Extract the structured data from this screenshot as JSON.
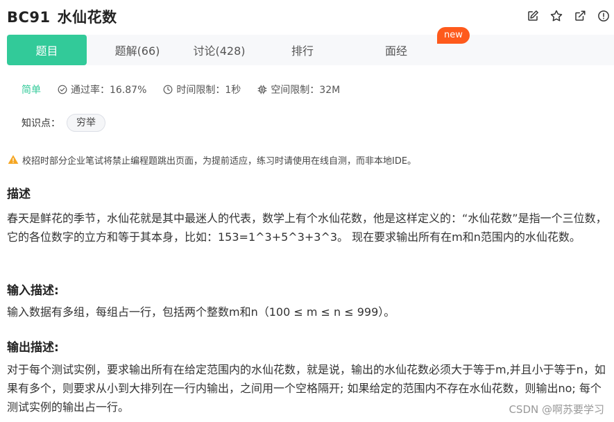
{
  "problem": {
    "code": "BC91",
    "title": "水仙花数"
  },
  "header_icons": [
    "edit-icon",
    "star-icon",
    "share-icon",
    "report-icon"
  ],
  "tabs": [
    {
      "label": "题目",
      "active": true
    },
    {
      "label": "题解(66)",
      "active": false
    },
    {
      "label": "讨论(428)",
      "active": false
    },
    {
      "label": "排行",
      "active": false
    },
    {
      "label": "面经",
      "active": false
    }
  ],
  "badge_new": "new",
  "meta": {
    "difficulty": "简单",
    "pass_rate": "通过率：16.87%",
    "time_limit": "时间限制：1秒",
    "memory_limit": "空间限制：32M"
  },
  "knowledge": {
    "label": "知识点：",
    "tags": [
      "穷举"
    ]
  },
  "notice": "校招时部分企业笔试将禁止编程题跳出页面，为提前适应，练习时请使用在线自测，而非本地IDE。",
  "description": {
    "title": "描述",
    "text": "春天是鲜花的季节，水仙花就是其中最迷人的代表，数学上有个水仙花数，他是这样定义的：“水仙花数”是指一个三位数，它的各位数字的立方和等于其本身，比如：153=1^3+5^3+3^3。 现在要求输出所有在m和n范围内的水仙花数。"
  },
  "input_desc": {
    "title": "输入描述:",
    "text": "输入数据有多组，每组占一行，包括两个整数m和n（100 ≤ m ≤ n ≤ 999）。"
  },
  "output_desc": {
    "title": "输出描述:",
    "text": "对于每个测试实例，要求输出所有在给定范围内的水仙花数，就是说，输出的水仙花数必须大于等于m,并且小于等于n，如果有多个，则要求从小到大排列在一行内输出，之间用一个空格隔开; 如果给定的范围内不存在水仙花数，则输出no; 每个测试实例的输出占一行。"
  },
  "watermark": "CSDN @啊苏要学习",
  "colors": {
    "accent": "#32ca99",
    "badge": "#fe5a1c",
    "warning": "#f5a623"
  }
}
